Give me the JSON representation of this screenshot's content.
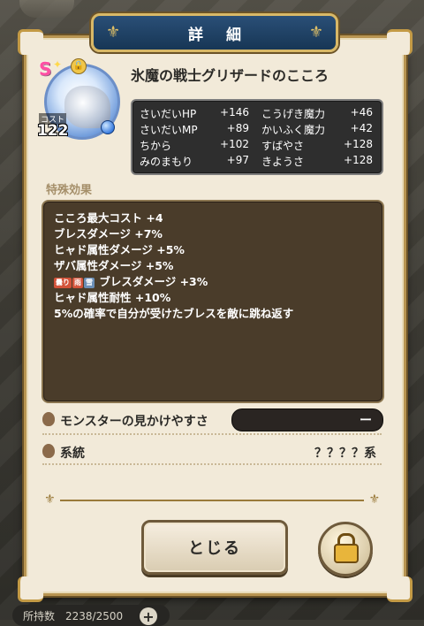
{
  "dialog": {
    "title": "詳 細",
    "close_label": "とじる"
  },
  "monster": {
    "name": "氷魔の戦士グリザードのこころ",
    "rank": "S",
    "cost_label": "コスト",
    "cost": "122"
  },
  "stats": [
    {
      "left_name": "さいだいHP",
      "left_value": "+146",
      "right_name": "こうげき魔力",
      "right_value": "+46"
    },
    {
      "left_name": "さいだいMP",
      "left_value": "+89",
      "right_name": "かいふく魔力",
      "right_value": "+42"
    },
    {
      "left_name": "ちから",
      "left_value": "+102",
      "right_name": "すばやさ",
      "right_value": "+128"
    },
    {
      "left_name": "みのまもり",
      "left_value": "+97",
      "right_name": "きようさ",
      "right_value": "+128"
    }
  ],
  "special_effects": {
    "label": "特殊効果",
    "lines": [
      "こころ最大コスト +4",
      "ブレスダメージ +7%",
      "ヒャド属性ダメージ +5%",
      "ザバ属性ダメージ +5%",
      "ブレスダメージ +3%",
      "ヒャド属性耐性 +10%",
      "5%の確率で自分が受けたブレスを敵に跳ね返す"
    ],
    "tags": [
      "曇り",
      "雨",
      "雪"
    ]
  },
  "appearance": {
    "label": "モンスターの見かけやすさ",
    "value": "ー"
  },
  "lineage": {
    "label": "系統",
    "value": "？？？？系"
  },
  "footer": {
    "owned": "所持数　2238/2500",
    "plus": "+"
  }
}
